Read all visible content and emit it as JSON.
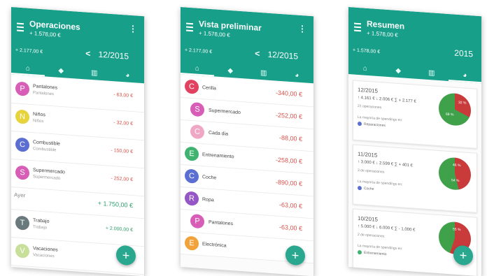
{
  "colors": {
    "teal": "#179f89",
    "red": "#d8524a",
    "green": "#2c9e6b",
    "pink": "#d75db7",
    "purple": "#9657c6",
    "yellow": "#e7d33b",
    "blue": "#5b6fd2",
    "orange": "#f2a23a",
    "gray": "#6a7a7c",
    "lime": "#c8df9a"
  },
  "screen1": {
    "title": "Operaciones",
    "subtitle": "+ 1.578,00 €",
    "balance": "+ 2.177,00 €",
    "nav_arrow": "<",
    "period": "12/2015",
    "tabs": [
      "home-icon",
      "tag-icon",
      "bars-icon",
      "pie-icon"
    ],
    "rows": [
      {
        "letter": "P",
        "name": "Pantalones",
        "sub": "Pantalones",
        "amount": "- 63,00 €",
        "color": "#d75db7",
        "type": "expense"
      },
      {
        "letter": "N",
        "name": "Niños",
        "sub": "Niños",
        "amount": "- 32,00 €",
        "color": "#e7d33b",
        "type": "expense"
      },
      {
        "letter": "C",
        "name": "Combustible",
        "sub": "Combustible",
        "amount": "- 150,00 €",
        "color": "#5b6fd2",
        "type": "expense"
      },
      {
        "letter": "S",
        "name": "Supermercado",
        "sub": "Supermercado",
        "amount": "- 252,00 €",
        "color": "#d75db7",
        "type": "expense"
      }
    ],
    "section": "Ayer",
    "section_amount": "+ 1.750,00 €",
    "rows2": [
      {
        "letter": "T",
        "name": "Trabajo",
        "sub": "Trabajo",
        "amount": "+ 2.000,00 €",
        "color": "#6a7a7c",
        "type": "income"
      },
      {
        "letter": "V",
        "name": "Vacaciones",
        "sub": "Vacaciones",
        "amount": "",
        "color": "#c8df9a",
        "type": "expense"
      }
    ],
    "fab": "+"
  },
  "screen2": {
    "title": "Vista preliminar",
    "subtitle": "+ 1.578,00 €",
    "balance": "+ 2.177,00 €",
    "nav_arrow": "<",
    "period": "12/2015",
    "rows": [
      {
        "letter": "C",
        "name": "Cerilla",
        "amount": "-340,00 €",
        "color": "#e2415f"
      },
      {
        "letter": "S",
        "name": "Supermercado",
        "amount": "-252,00 €",
        "color": "#d75db7"
      },
      {
        "letter": "C",
        "name": "Cada dia",
        "amount": "-88,00 €",
        "color": "#f0a6c5"
      },
      {
        "letter": "E",
        "name": "Entrenamiento",
        "amount": "-258,00 €",
        "color": "#3fb36f"
      },
      {
        "letter": "C",
        "name": "Coche",
        "amount": "-890,00 €",
        "color": "#5b6fd2"
      },
      {
        "letter": "R",
        "name": "Ropa",
        "amount": "-63,00 €",
        "color": "#9657c6"
      },
      {
        "letter": "P",
        "name": "Pantalones",
        "amount": "-63,00 €",
        "color": "#d75db7"
      },
      {
        "letter": "E",
        "name": "Electrónica",
        "amount": "",
        "color": "#f2a23a"
      }
    ],
    "fab": "+"
  },
  "screen3": {
    "title": "Resumen",
    "subtitle": "+ 1.578,00 €",
    "balance": "+ 1.578,00 €",
    "year": "2015",
    "cards": [
      {
        "date": "12/2015",
        "stats": "↑ 4.161 €  ↓ 2.006 €  ∑ + 2.177 €",
        "note": "21 operaciones",
        "legend": "La mayoría de spendings en:",
        "category": "Reparaciones",
        "dot": "#5b6fd2",
        "red_pct": 32,
        "green_pct": 68
      },
      {
        "date": "11/2015",
        "stats": "↑ 3.000 €  ↓ 2.599 €  ∑ + 401 €",
        "note": "3 de operaciones",
        "legend": "La mayoría de spendings en:",
        "category": "Coche",
        "dot": "#5b6fd2",
        "red_pct": 46,
        "green_pct": 54
      },
      {
        "date": "10/2015",
        "stats": "↑ 5.000 €  ↓ 6.000 €  ∑ - 1.000 €",
        "note": "2 de operaciones",
        "legend": "La mayoría de spendings en:",
        "category": "Entrenamiento",
        "dot": "#3fb36f",
        "red_pct": 55,
        "green_pct": 45
      }
    ],
    "fab": "+"
  }
}
